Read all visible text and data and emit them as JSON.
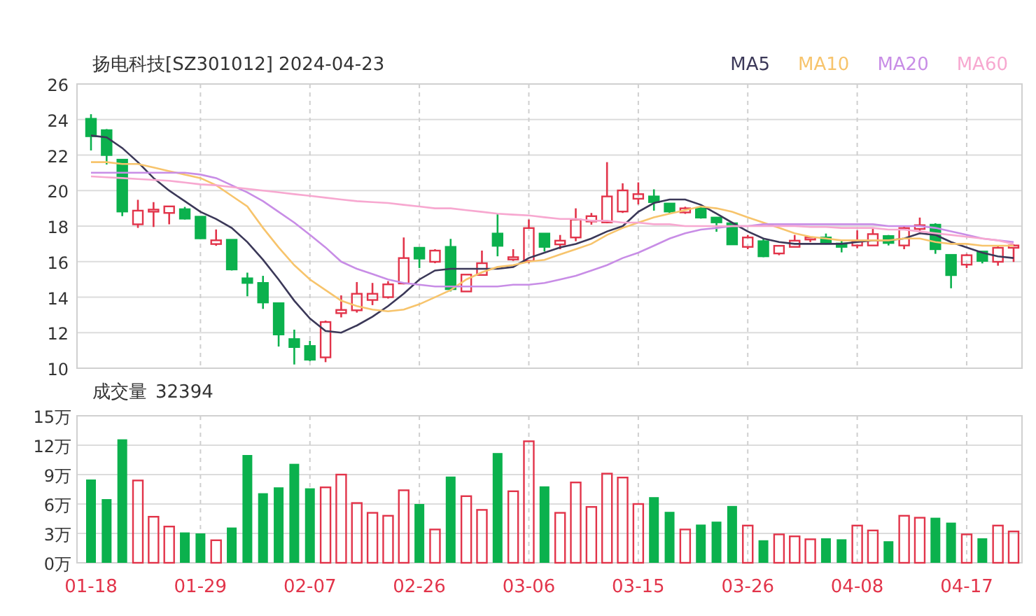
{
  "title": "扬电科技[SZ301012] 2024-04-23",
  "price_chart": {
    "chart_data": {
      "type": "candlestick",
      "grid": true,
      "ylim": [
        10,
        26
      ],
      "yticks": [
        10,
        12,
        14,
        16,
        18,
        20,
        22,
        24,
        26
      ],
      "categories": [
        null,
        null,
        null,
        null,
        null,
        null,
        null,
        null,
        null,
        null,
        null,
        null,
        null,
        null,
        null,
        null,
        null,
        null,
        null,
        null,
        null,
        null,
        null,
        null,
        null,
        null,
        null,
        null,
        null,
        null,
        null,
        null,
        null,
        null,
        null,
        null,
        null,
        null,
        null,
        null,
        null,
        null,
        null,
        null,
        null,
        null,
        null,
        null,
        null,
        null,
        null,
        null,
        null,
        null,
        null,
        null,
        null,
        null,
        null,
        null
      ],
      "ohlc": [
        [
          24.04,
          24.3,
          22.26,
          23.06
        ],
        [
          23.4,
          23.46,
          21.47,
          22.0
        ],
        [
          21.74,
          21.74,
          18.56,
          18.82
        ],
        [
          18.1,
          19.48,
          17.9,
          18.87
        ],
        [
          18.82,
          19.35,
          17.95,
          18.93
        ],
        [
          18.74,
          19.11,
          18.1,
          19.11
        ],
        [
          18.95,
          19.08,
          18.37,
          18.42
        ],
        [
          18.53,
          18.53,
          17.28,
          17.31
        ],
        [
          16.99,
          17.81,
          16.89,
          17.2
        ],
        [
          17.23,
          17.23,
          15.5,
          15.56
        ],
        [
          15.06,
          15.38,
          14.05,
          14.8
        ],
        [
          14.8,
          15.2,
          13.34,
          13.7
        ],
        [
          13.66,
          13.66,
          11.22,
          11.9
        ],
        [
          11.64,
          12.17,
          10.21,
          11.19
        ],
        [
          11.25,
          11.54,
          10.4,
          10.48
        ],
        [
          10.61,
          12.68,
          10.34,
          12.6
        ],
        [
          13.1,
          14.1,
          12.86,
          13.28
        ],
        [
          13.26,
          14.85,
          13.13,
          14.19
        ],
        [
          13.84,
          14.8,
          13.55,
          14.19
        ],
        [
          14.0,
          14.9,
          13.92,
          14.72
        ],
        [
          14.77,
          17.36,
          14.72,
          16.2
        ],
        [
          16.78,
          16.78,
          15.64,
          16.17
        ],
        [
          15.99,
          16.7,
          15.91,
          16.62
        ],
        [
          16.83,
          17.28,
          14.32,
          14.45
        ],
        [
          14.32,
          15.27,
          14.32,
          15.27
        ],
        [
          15.25,
          16.62,
          15.25,
          15.91
        ],
        [
          17.58,
          18.69,
          16.3,
          16.89
        ],
        [
          16.12,
          16.7,
          16.04,
          16.25
        ],
        [
          16.04,
          18.37,
          15.91,
          17.89
        ],
        [
          17.58,
          17.58,
          16.57,
          16.83
        ],
        [
          16.97,
          17.5,
          16.7,
          17.18
        ],
        [
          17.36,
          19.0,
          17.15,
          18.37
        ],
        [
          18.26,
          18.74,
          18.08,
          18.56
        ],
        [
          18.21,
          21.6,
          18.16,
          19.67
        ],
        [
          18.82,
          20.41,
          18.74,
          20.01
        ],
        [
          19.54,
          20.46,
          19.22,
          19.8
        ],
        [
          19.67,
          20.07,
          18.87,
          19.35
        ],
        [
          19.27,
          19.27,
          18.69,
          18.82
        ],
        [
          18.77,
          19.09,
          18.69,
          19.0
        ],
        [
          19.0,
          19.08,
          18.42,
          18.48
        ],
        [
          18.48,
          18.48,
          17.68,
          18.21
        ],
        [
          18.16,
          18.16,
          16.97,
          16.97
        ],
        [
          16.83,
          17.5,
          16.7,
          17.36
        ],
        [
          17.15,
          17.28,
          16.25,
          16.3
        ],
        [
          16.46,
          16.89,
          16.36,
          16.89
        ],
        [
          16.83,
          17.5,
          16.83,
          17.18
        ],
        [
          17.26,
          17.36,
          17.1,
          17.36
        ],
        [
          17.36,
          17.58,
          16.97,
          17.05
        ],
        [
          17.02,
          17.23,
          16.52,
          16.83
        ],
        [
          16.91,
          17.76,
          16.75,
          17.18
        ],
        [
          16.91,
          17.84,
          16.91,
          17.55
        ],
        [
          17.44,
          17.5,
          16.91,
          17.05
        ],
        [
          16.91,
          18.03,
          16.7,
          17.89
        ],
        [
          17.84,
          18.48,
          17.68,
          18.05
        ],
        [
          18.08,
          18.16,
          16.44,
          16.7
        ],
        [
          16.38,
          16.38,
          14.5,
          15.24
        ],
        [
          15.83,
          16.44,
          15.64,
          16.36
        ],
        [
          16.57,
          16.57,
          15.9,
          16.04
        ],
        [
          15.99,
          16.91,
          15.77,
          16.78
        ],
        [
          16.78,
          16.97,
          15.98,
          16.91
        ]
      ],
      "series": [
        {
          "name": "MA5",
          "type": "line",
          "color": "#3b3858",
          "values": [
            23.1,
            23.0,
            22.4,
            21.6,
            20.7,
            20.0,
            19.4,
            18.8,
            18.4,
            17.9,
            17.1,
            16.1,
            15.0,
            13.8,
            12.8,
            12.1,
            12.0,
            12.4,
            12.9,
            13.5,
            14.2,
            15.0,
            15.5,
            15.6,
            15.6,
            15.6,
            15.6,
            15.7,
            16.2,
            16.5,
            16.8,
            17.0,
            17.3,
            17.7,
            18.0,
            18.8,
            19.3,
            19.5,
            19.5,
            19.2,
            18.7,
            18.2,
            17.7,
            17.3,
            17.1,
            17.0,
            17.0,
            17.0,
            17.0,
            17.1,
            17.2,
            17.2,
            17.3,
            17.6,
            17.5,
            17.1,
            16.8,
            16.5,
            16.3,
            16.2
          ]
        },
        {
          "name": "MA10",
          "type": "line",
          "color": "#f7c46c",
          "values": [
            21.6,
            21.6,
            21.5,
            21.5,
            21.3,
            21.1,
            20.9,
            20.7,
            20.3,
            19.7,
            19.1,
            17.9,
            16.8,
            15.8,
            15.0,
            14.4,
            13.8,
            13.5,
            13.3,
            13.2,
            13.3,
            13.6,
            14.0,
            14.4,
            15.0,
            15.4,
            15.7,
            15.8,
            16.0,
            16.1,
            16.4,
            16.7,
            17.0,
            17.5,
            17.9,
            18.2,
            18.5,
            18.7,
            18.9,
            19.1,
            19.0,
            18.8,
            18.5,
            18.2,
            17.9,
            17.6,
            17.4,
            17.3,
            17.2,
            17.2,
            17.2,
            17.2,
            17.3,
            17.3,
            17.1,
            17.0,
            17.0,
            16.9,
            16.9,
            16.9
          ]
        },
        {
          "name": "MA20",
          "type": "line",
          "color": "#c88de6",
          "values": [
            21.0,
            21.0,
            21.0,
            21.0,
            21.0,
            21.0,
            21.0,
            20.9,
            20.7,
            20.3,
            19.9,
            19.4,
            18.8,
            18.2,
            17.5,
            16.8,
            16.0,
            15.6,
            15.3,
            15.0,
            14.8,
            14.7,
            14.6,
            14.6,
            14.6,
            14.6,
            14.6,
            14.7,
            14.7,
            14.8,
            15.0,
            15.2,
            15.5,
            15.8,
            16.2,
            16.5,
            16.9,
            17.3,
            17.6,
            17.8,
            17.9,
            18.0,
            18.0,
            18.1,
            18.1,
            18.1,
            18.1,
            18.1,
            18.1,
            18.1,
            18.1,
            18.0,
            18.0,
            18.0,
            17.9,
            17.7,
            17.5,
            17.3,
            17.2,
            17.1
          ]
        },
        {
          "name": "MA60",
          "type": "line",
          "color": "#f7a8d0",
          "values": [
            20.8,
            20.75,
            20.7,
            20.65,
            20.6,
            20.55,
            20.45,
            20.35,
            20.3,
            20.2,
            20.1,
            20.0,
            19.9,
            19.8,
            19.7,
            19.6,
            19.5,
            19.4,
            19.35,
            19.3,
            19.2,
            19.1,
            19.0,
            19.0,
            18.9,
            18.8,
            18.7,
            18.65,
            18.6,
            18.5,
            18.4,
            18.4,
            18.3,
            18.3,
            18.2,
            18.2,
            18.1,
            18.1,
            18.0,
            18.0,
            18.0,
            18.0,
            18.0,
            18.0,
            18.0,
            18.0,
            17.95,
            17.95,
            17.9,
            17.9,
            17.9,
            17.8,
            17.8,
            17.7,
            17.6,
            17.5,
            17.4,
            17.3,
            17.2,
            17.0
          ]
        }
      ]
    }
  },
  "volume_chart": {
    "label": "成交量",
    "value": "32394",
    "chart_data": {
      "type": "bar",
      "stacked": true,
      "grid": true,
      "ylim": [
        0,
        15
      ],
      "yticks": [
        {
          "value": 0,
          "label": "0万"
        },
        {
          "value": 3,
          "label": "3万"
        },
        {
          "value": 6,
          "label": "6万"
        },
        {
          "value": 9,
          "label": "9万"
        },
        {
          "value": 12,
          "label": "12万"
        },
        {
          "value": 15,
          "label": "15万"
        }
      ],
      "categories": [
        "01-18",
        null,
        null,
        null,
        null,
        null,
        null,
        "01-29",
        null,
        null,
        null,
        null,
        null,
        null,
        "02-07",
        null,
        null,
        null,
        null,
        null,
        null,
        "02-26",
        null,
        null,
        null,
        null,
        null,
        null,
        "03-06",
        null,
        null,
        null,
        null,
        null,
        null,
        "03-15",
        null,
        null,
        null,
        null,
        null,
        null,
        "03-26",
        null,
        null,
        null,
        null,
        null,
        null,
        "04-08",
        null,
        null,
        null,
        null,
        null,
        null,
        "04-17",
        null,
        null,
        null
      ],
      "series": [
        {
          "color": "#e2344a",
          "values": [
            null,
            null,
            null,
            8.4,
            4.7,
            3.7,
            null,
            null,
            2.3,
            null,
            null,
            null,
            null,
            null,
            null,
            7.7,
            9.0,
            6.1,
            5.1,
            4.8,
            7.4,
            null,
            3.4,
            null,
            6.8,
            5.4,
            null,
            7.3,
            12.4,
            null,
            5.1,
            8.2,
            5.7,
            9.1,
            8.7,
            6.0,
            null,
            null,
            3.4,
            null,
            null,
            null,
            3.8,
            null,
            2.9,
            2.7,
            2.4,
            null,
            null,
            3.8,
            3.3,
            null,
            4.8,
            4.6,
            null,
            null,
            2.9,
            null,
            3.8,
            3.2
          ]
        },
        {
          "color": "#0bb14d",
          "values": [
            8.5,
            6.5,
            12.6,
            null,
            null,
            null,
            3.1,
            3.0,
            null,
            3.6,
            11.0,
            7.1,
            7.7,
            10.1,
            7.6,
            null,
            null,
            null,
            null,
            null,
            null,
            6.0,
            null,
            8.8,
            null,
            null,
            11.2,
            null,
            null,
            7.8,
            null,
            null,
            null,
            null,
            null,
            null,
            6.7,
            5.2,
            null,
            3.9,
            4.2,
            5.8,
            null,
            2.3,
            null,
            null,
            null,
            2.5,
            2.4,
            null,
            null,
            2.2,
            null,
            null,
            4.6,
            4.1,
            null,
            2.5,
            null,
            null
          ]
        }
      ]
    }
  }
}
